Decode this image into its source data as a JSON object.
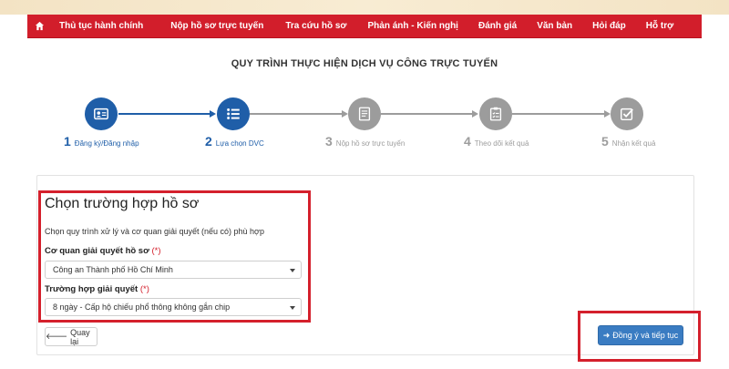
{
  "nav": {
    "home_icon": "home-icon",
    "items": [
      {
        "label": "Thủ tục hành chính"
      },
      {
        "label": "Nộp hồ sơ trực tuyến"
      },
      {
        "label": "Tra cứu hồ sơ"
      },
      {
        "label": "Phản ánh - Kiến nghị"
      },
      {
        "label": "Đánh giá"
      },
      {
        "label": "Văn bản"
      },
      {
        "label": "Hỏi đáp"
      },
      {
        "label": "Hỗ trợ"
      }
    ]
  },
  "page": {
    "title": "QUY TRÌNH THỰC HIỆN DỊCH VỤ CÔNG TRỰC TUYẾN"
  },
  "steps": [
    {
      "number": "1",
      "label": "Đăng ký/Đăng nhập",
      "icon": "id-card-icon",
      "state": "done"
    },
    {
      "number": "2",
      "label": "Lựa chọn DVC",
      "icon": "list-icon",
      "state": "active"
    },
    {
      "number": "3",
      "label": "Nộp hồ sơ trực tuyến",
      "icon": "document-icon",
      "state": "pending"
    },
    {
      "number": "4",
      "label": "Theo dõi kết quả",
      "icon": "clipboard-icon",
      "state": "pending"
    },
    {
      "number": "5",
      "label": "Nhận kết quả",
      "icon": "check-square-icon",
      "state": "pending"
    }
  ],
  "form": {
    "heading": "Chọn trường hợp hồ sơ",
    "description": "Chọn quy trình xử lý và cơ quan giải quyết (nếu có) phù hợp",
    "agency": {
      "label": "Cơ quan giải quyết hồ sơ",
      "required_mark": "(*)",
      "selected": "Công an Thành phố Hồ Chí Minh"
    },
    "case": {
      "label": "Trường hợp giải quyết",
      "required_mark": "(*)",
      "selected": "8 ngày - Cấp hộ chiếu phổ thông không gắn chip"
    },
    "back_label": "Quay lại",
    "continue_label": "Đồng ý và tiếp tục"
  },
  "colors": {
    "nav_red": "#d21e2b",
    "active_blue": "#1f5ea8",
    "inactive_gray": "#9c9c9c",
    "highlight_red": "#d4202c",
    "button_blue": "#3a7cc2"
  }
}
